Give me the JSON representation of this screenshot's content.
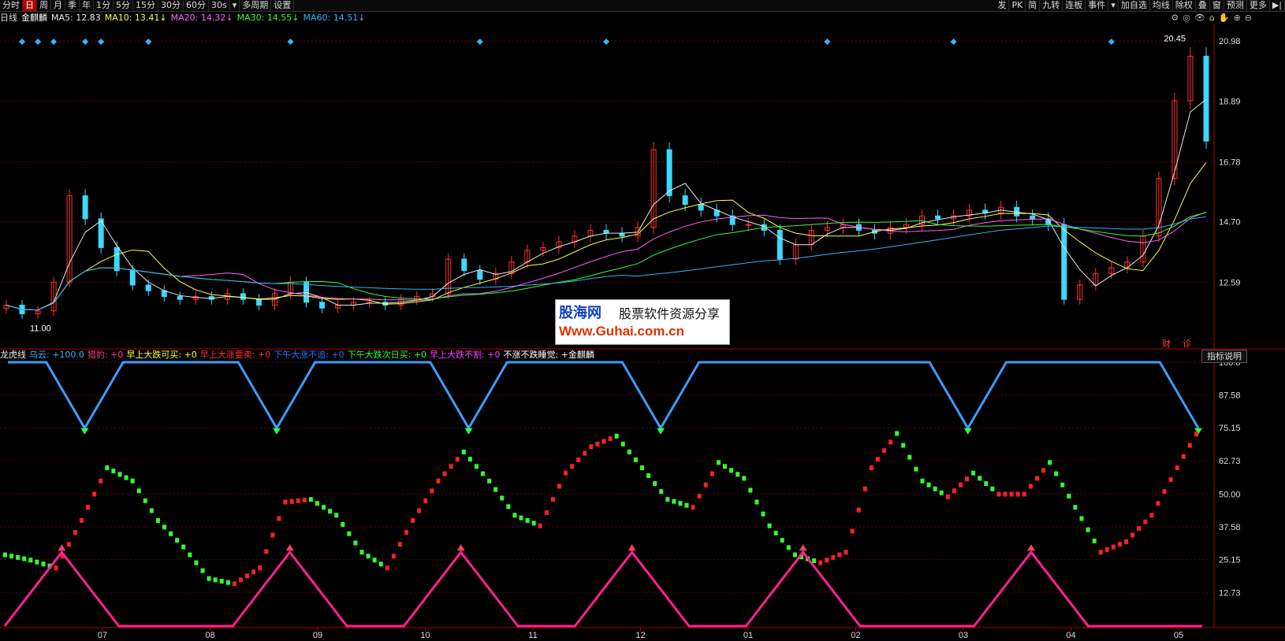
{
  "toolbar": {
    "left": [
      "分时",
      "日",
      "周",
      "月",
      "季",
      "年",
      "1分",
      "5分",
      "15分",
      "30分",
      "60分",
      "30s",
      "▾",
      "多周期",
      "设置"
    ],
    "active_index": 1,
    "right": [
      "发",
      "PK",
      "简",
      "九转",
      "连板",
      "事件",
      "▾",
      "加自选",
      "均线",
      "除权",
      "叠",
      "窗",
      "预测",
      "更多",
      "▶|"
    ]
  },
  "ma": {
    "prefix": "日线",
    "name": "金麒麟",
    "ma5": "MA5: 12.83",
    "ma10": "MA10: 13.41↓",
    "ma20": "MA20: 14.32↓",
    "ma30": "MA30: 14.55↓",
    "ma60": "MA60: 14.51↓"
  },
  "top_icons": [
    "⚙",
    "◎",
    "👁",
    "⌂",
    "✋",
    "⊕",
    "⊖"
  ],
  "indicator": {
    "items": [
      {
        "text": "龙虎线",
        "color": "#e8e8e8"
      },
      {
        "text": "乌云: +100.0",
        "color": "#4aa8ff"
      },
      {
        "text": "猎豹: +0",
        "color": "#ff3a8c"
      },
      {
        "text": "早上大跌可买: +0",
        "color": "#ffff40"
      },
      {
        "text": "早上大涨要卖: +0",
        "color": "#ff3030"
      },
      {
        "text": "下午大涨不追: +0",
        "color": "#2d6bff"
      },
      {
        "text": "下午大跌次日买: +0",
        "color": "#30ff30"
      },
      {
        "text": "早上大跌不割: +0",
        "color": "#ff40ff"
      },
      {
        "text": "不涨不跌睡觉: +金麒麟",
        "color": "#ffffff"
      }
    ],
    "explain_button": "指标说明"
  },
  "buttons": {
    "cai": "财",
    "zhen": "诊"
  },
  "colors": {
    "up": "#ff3030",
    "down": "#3cd8ff",
    "ma5": "#e8e8e8",
    "ma10": "#ffff40",
    "ma20": "#ff60ff",
    "ma30": "#30ff30",
    "ma60": "#32b4ff",
    "grid": "#5a0000",
    "axis": "#aa0000",
    "osc_up": "#ff2020",
    "osc_down": "#30ff30",
    "cloud": "#3c9cff",
    "spike": "#ff2090"
  },
  "price_axis": {
    "labels": [
      "20.98",
      "18.89",
      "16.78",
      "14.70",
      "12.59"
    ]
  },
  "price_marks": {
    "high": "20.45",
    "low": "11.00"
  },
  "osc_axis": {
    "labels": [
      "100.0",
      "87.58",
      "75.15",
      "62.73",
      "50.00",
      "37.58",
      "25.15",
      "12.73"
    ]
  },
  "date_axis": {
    "labels": [
      "07",
      "08",
      "09",
      "10",
      "11",
      "12",
      "01",
      "02",
      "03",
      "04",
      "05"
    ]
  },
  "watermark": {
    "logo": "股海网",
    "sub": "股票软件资源分享",
    "url": "Www.Guhai.com.cn"
  },
  "chart_data": [
    {
      "type": "candlestick",
      "title": "金麒麟",
      "ylim": [
        10.5,
        21.5
      ],
      "yticks": [
        20.98,
        18.89,
        16.78,
        14.7,
        12.59
      ],
      "close_series": [
        11.8,
        11.5,
        11.6,
        12.6,
        15.6,
        14.8,
        13.8,
        13.0,
        12.5,
        12.3,
        12.1,
        12.0,
        12.1,
        12.0,
        12.2,
        12.0,
        11.8,
        12.2,
        12.6,
        11.9,
        11.7,
        11.8,
        11.9,
        11.9,
        11.8,
        12.0,
        12.1,
        12.2,
        13.4,
        13.0,
        12.7,
        12.9,
        13.3,
        13.7,
        13.8,
        14.0,
        14.2,
        14.4,
        14.3,
        14.2,
        14.5,
        17.2,
        15.6,
        15.3,
        15.1,
        14.9,
        14.6,
        14.6,
        14.4,
        13.4,
        13.9,
        14.4,
        14.5,
        14.6,
        14.4,
        14.3,
        14.5,
        14.6,
        14.9,
        14.8,
        14.9,
        15.1,
        15.0,
        15.2,
        14.9,
        14.8,
        14.6,
        12.0,
        12.5,
        12.9,
        13.1,
        13.3,
        14.2,
        16.2,
        18.9,
        20.45,
        17.5
      ],
      "ma_series": [
        "MA5",
        "MA10",
        "MA20",
        "MA30",
        "MA60"
      ]
    },
    {
      "type": "line",
      "title": "龙虎线",
      "ylim": [
        0,
        100
      ],
      "yticks": [
        100.0,
        87.58,
        75.15,
        62.73,
        50.0,
        37.58,
        25.15,
        12.73
      ],
      "x": [
        "07",
        "08",
        "09",
        "10",
        "11",
        "12",
        "01",
        "02",
        "03",
        "04",
        "05"
      ],
      "series": [
        {
          "name": "乌云",
          "values": [
            100,
            100,
            75,
            100,
            100,
            100,
            100,
            75,
            100,
            100,
            100,
            100,
            75,
            100,
            100,
            100,
            100,
            75,
            100,
            100,
            100,
            100,
            100,
            100,
            100,
            75,
            100,
            100,
            100,
            100,
            100,
            75
          ]
        },
        {
          "name": "龙虎线",
          "values": [
            27,
            25,
            22,
            40,
            60,
            55,
            40,
            30,
            18,
            16,
            22,
            47,
            48,
            42,
            28,
            22,
            40,
            55,
            66,
            55,
            42,
            38,
            58,
            68,
            72,
            60,
            48,
            45,
            62,
            56,
            38,
            27,
            24,
            28,
            60,
            73,
            55,
            49,
            58,
            50,
            50,
            62,
            45,
            28,
            32,
            42,
            60,
            77
          ]
        },
        {
          "name": "猎豹",
          "values": [
            0,
            28,
            0,
            0,
            0,
            28,
            0,
            0,
            28,
            0,
            0,
            28,
            0,
            0,
            28,
            0,
            0,
            0,
            28,
            0,
            0,
            0
          ]
        }
      ]
    }
  ]
}
